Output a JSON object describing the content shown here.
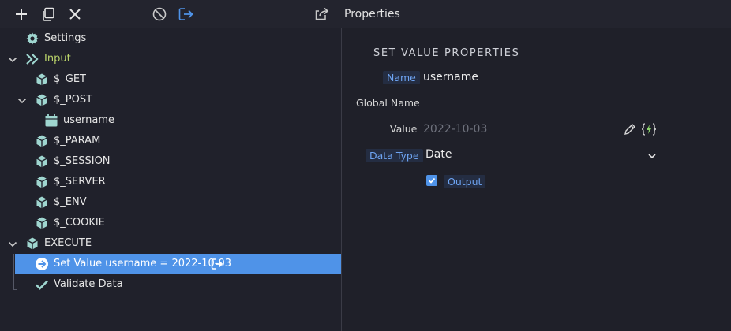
{
  "toolbar": {
    "icons": [
      "add-icon",
      "duplicate-icon",
      "close-icon",
      "disable-icon",
      "output-icon",
      "export-icon"
    ],
    "properties_title": "Properties"
  },
  "tree": {
    "settings": "Settings",
    "input": "Input",
    "get": "$_GET",
    "post": "$_POST",
    "username": "username",
    "param": "$_PARAM",
    "session": "$_SESSION",
    "server": "$_SERVER",
    "env": "$_ENV",
    "cookie": "$_COOKIE",
    "execute": "EXECUTE",
    "set_value": "Set Value username = 2022-10-03",
    "validate": "Validate Data"
  },
  "properties": {
    "section_title": "SET VALUE PROPERTIES",
    "name_label": "Name",
    "name_value": "username",
    "global_name_label": "Global Name",
    "global_name_value": "",
    "value_label": "Value",
    "value_placeholder": "2022-10-03",
    "data_type_label": "Data Type",
    "data_type_value": "Date",
    "output_label": "Output",
    "output_checked": true
  },
  "colors": {
    "accent": "#4f93e8",
    "input_green": "#b9d36a",
    "teal_icon": "#9fd6d0",
    "lightning": "#8bd36a"
  }
}
